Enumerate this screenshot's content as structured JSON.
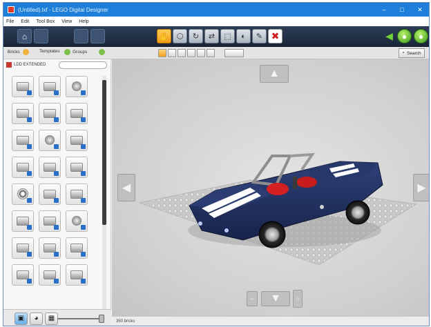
{
  "window": {
    "title": "(Untitled).lxf - LEGO Digital Designer"
  },
  "window_controls": {
    "minimize": "–",
    "maximize": "□",
    "close": "✕"
  },
  "menu": [
    "File",
    "Edit",
    "Tool Box",
    "View",
    "Help"
  ],
  "toolbar": {
    "home_icon": "⌂",
    "delete_icon": "✖",
    "tools": [
      "✋",
      "⬡",
      "↻",
      "⇄",
      "⬚",
      "◐",
      "✎"
    ]
  },
  "subbar": {
    "tabs": [
      "Bricks",
      "Templates",
      "Groups"
    ],
    "search_label": "Search"
  },
  "palette": {
    "header": "LDD EXTENDED",
    "cells": [
      "brick",
      "brick",
      "round",
      "brick",
      "brick",
      "brick",
      "brick",
      "round",
      "brick",
      "brick",
      "brick",
      "brick",
      "dark",
      "brick",
      "brick",
      "brick",
      "brick",
      "round",
      "brick",
      "brick",
      "brick",
      "brick",
      "brick",
      "brick"
    ]
  },
  "status": {
    "text": "350 bricks"
  },
  "colors": {
    "accent": "#1d7fd9",
    "car_body": "#1f2f5e",
    "stripe": "#ffffff",
    "seats": "#d81f1f"
  }
}
